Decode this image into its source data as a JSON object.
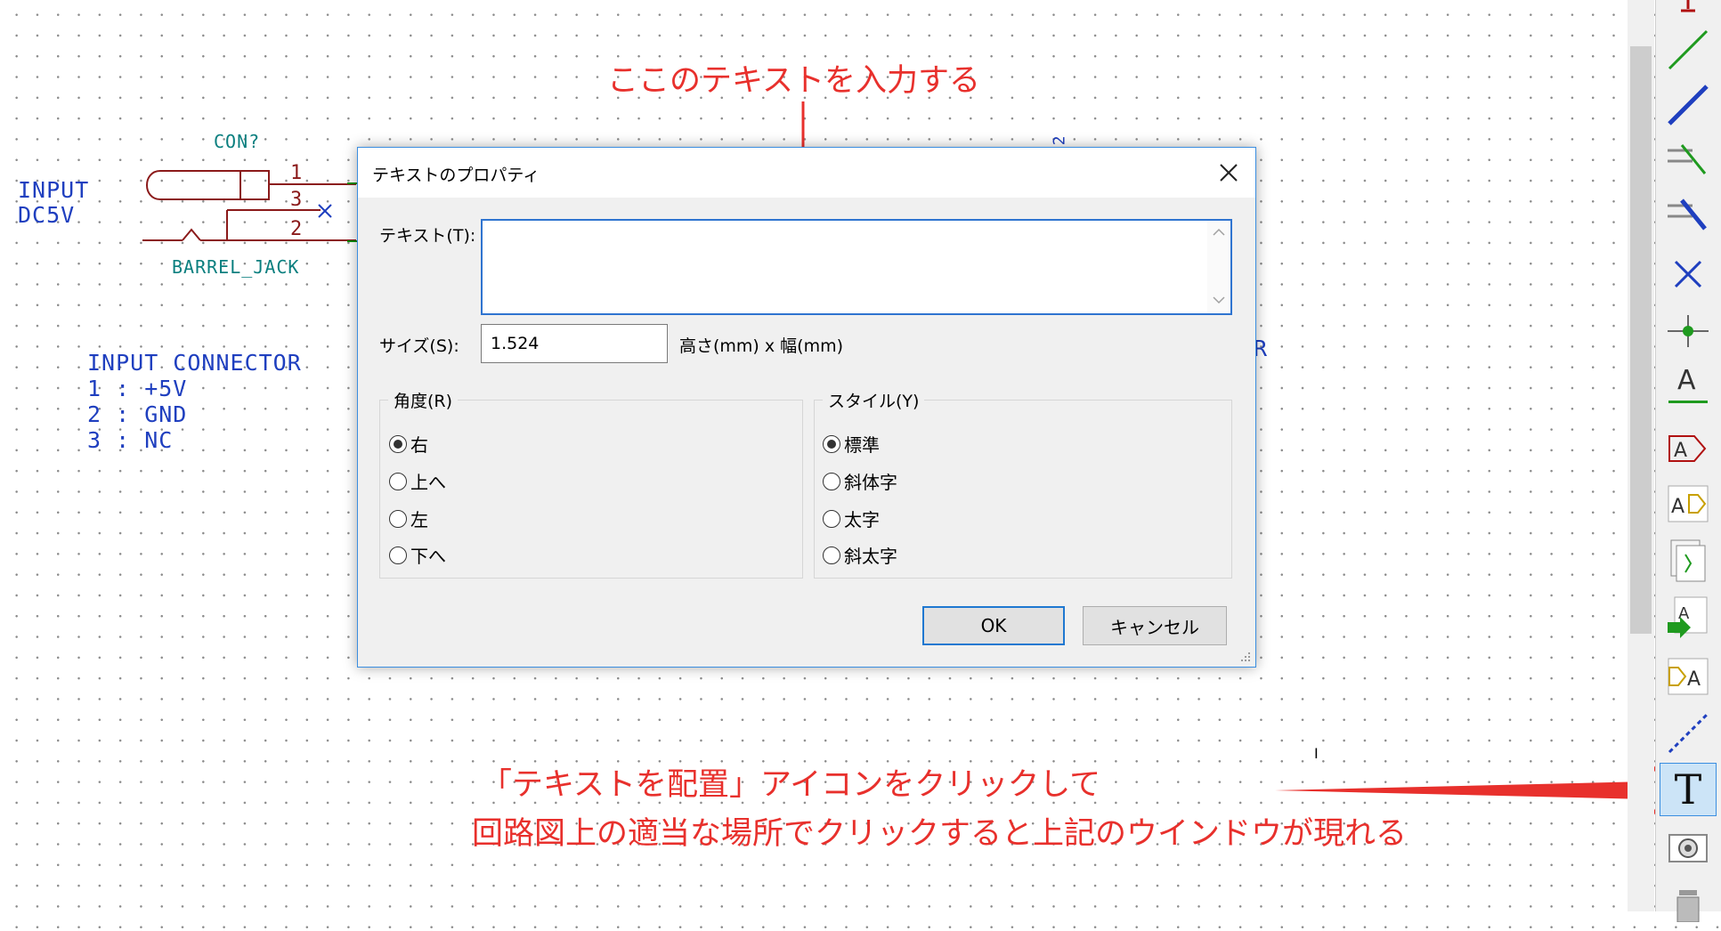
{
  "schematic": {
    "connector_ref": "CON?",
    "connector_value": "BARREL_JACK",
    "pin1": "1",
    "pin2": "2",
    "pin3": "3",
    "input_label_line1": "INPUT",
    "input_label_line2": "DC5V",
    "note_title": "INPUT CONNECTOR",
    "note_line1": "1 : +5V",
    "note_line2": "2 : GND",
    "note_line3": "3 : NC",
    "offscreen_ref_fragment": "2",
    "offscreen_text_fragment": "R",
    "cursor_mark": "I"
  },
  "annotations": {
    "top": "ここのテキストを入力する",
    "bottom_line1": "「テキストを配置」アイコンをクリックして",
    "bottom_line2": "回路図上の適当な場所でクリックすると上記のウインドウが現れる"
  },
  "dialog": {
    "title": "テキストのプロパティ",
    "text_label": "テキスト(T):",
    "text_value": "",
    "size_label": "サイズ(S):",
    "size_value": "1.524",
    "size_unit": "高さ(mm) x 幅(mm)",
    "angle_group": "角度(R)",
    "angle_options": [
      "右",
      "上へ",
      "左",
      "下へ"
    ],
    "angle_selected": "右",
    "style_group": "スタイル(Y)",
    "style_options": [
      "標準",
      "斜体字",
      "太字",
      "斜太字"
    ],
    "style_selected": "標準",
    "ok_label": "OK",
    "cancel_label": "キャンセル"
  },
  "toolbar": {
    "tools": [
      "power-port-icon",
      "wire-icon",
      "bus-icon",
      "wire-to-bus-entry-icon",
      "bus-to-bus-entry-icon",
      "no-connect-icon",
      "junction-icon",
      "net-label-icon",
      "global-label-icon",
      "hierarchical-label-icon",
      "hierarchical-sheet-icon",
      "import-sheet-pin-icon",
      "hierarchical-pin-icon",
      "graphic-line-icon",
      "place-text-icon",
      "image-icon",
      "delete-icon"
    ],
    "active_tool": "place-text-icon",
    "text_tool_glyph": "T",
    "label_tool_glyph": "A"
  },
  "colors": {
    "annotation": "#e8302c",
    "schematic_text": "#1f3fbf",
    "field_text": "#0a7f7f",
    "pin_text": "#8b1a1a",
    "dialog_accent": "#3b8ee0"
  }
}
